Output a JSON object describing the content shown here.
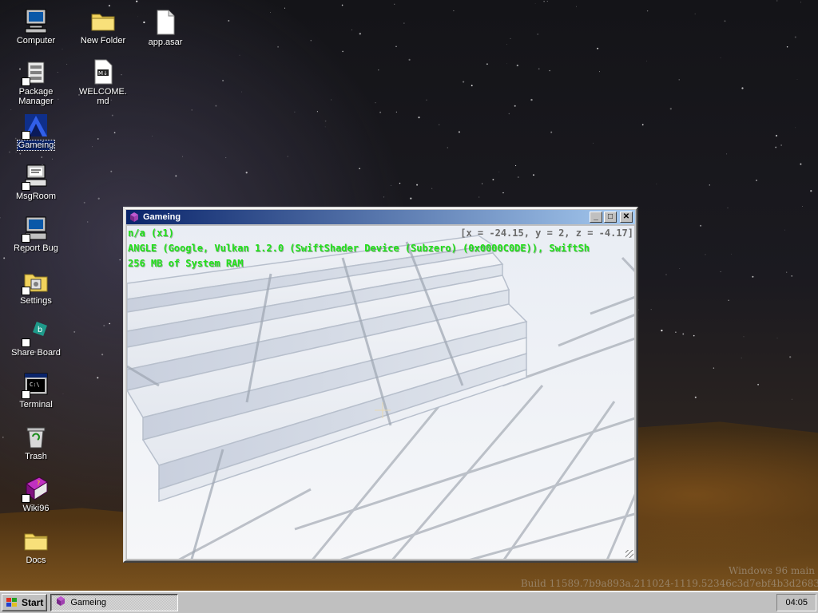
{
  "desktop": {
    "icons": [
      {
        "label": "Computer",
        "icon": "computer-icon",
        "selected": false
      },
      {
        "label": "New Folder",
        "icon": "folder-icon",
        "selected": false
      },
      {
        "label": "app.asar",
        "icon": "file-icon",
        "selected": false
      },
      {
        "label": "Package Manager",
        "icon": "package-manager-icon",
        "selected": false
      },
      {
        "label": "WELCOME.md",
        "icon": "markdown-file-icon",
        "selected": false
      },
      {
        "label": "Gameing",
        "icon": "gameing-icon",
        "selected": true
      },
      {
        "label": "MsgRoom",
        "icon": "msgroom-icon",
        "selected": false
      },
      {
        "label": "Report Bug",
        "icon": "report-bug-icon",
        "selected": false
      },
      {
        "label": "Settings",
        "icon": "settings-icon",
        "selected": false
      },
      {
        "label": "Share Board",
        "icon": "share-board-icon",
        "selected": false
      },
      {
        "label": "Terminal",
        "icon": "terminal-icon",
        "selected": false
      },
      {
        "label": "Trash",
        "icon": "trash-icon",
        "selected": false
      },
      {
        "label": "Wiki96",
        "icon": "wiki-book-icon",
        "selected": false
      },
      {
        "label": "Docs",
        "icon": "folder-icon",
        "selected": false
      }
    ],
    "watermark": {
      "line1": "Windows 96 main",
      "line2": "Build 11589.7b9a893a.211024-1119.52346c3d7ebf4b3d2683"
    }
  },
  "window": {
    "title": "Gameing",
    "icon": "gameing-icon",
    "buttons": {
      "minimize": "_",
      "maximize": "□",
      "close": "✕"
    },
    "hud": {
      "fps": "n/a (x1)",
      "position": "[x = -24.15, y = 2, z = -4.17]",
      "renderer": "ANGLE (Google, Vulkan 1.2.0 (SwiftShader Device (Subzero) (0x0000C0DE)), SwiftSh",
      "memory": "256 MB of System RAM"
    }
  },
  "taskbar": {
    "start_label": "Start",
    "tasks": [
      {
        "label": "Gameing",
        "icon": "gameing-icon"
      }
    ],
    "clock": "04:05"
  },
  "colors": {
    "hud_text": "#22e01a",
    "title_active_start": "#0a246a",
    "title_active_end": "#a6caf0",
    "chrome": "#c0c0c0"
  }
}
